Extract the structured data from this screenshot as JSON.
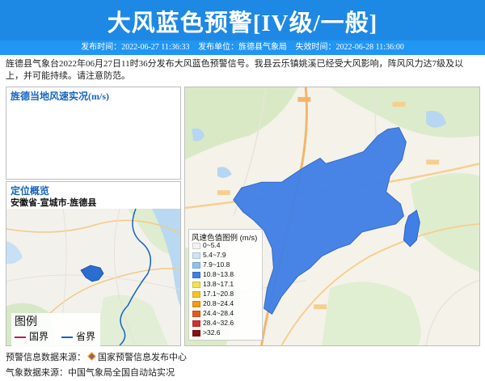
{
  "header": {
    "title": "大风蓝色预警[IV级/一般]",
    "publish_time": "发布时间：2022-06-27 11:36:33",
    "publisher": "发布单位：旌德县气象局",
    "expire_time": "失效时间：2022-06-28 11:36:00",
    "banner_color": "#1e88e5"
  },
  "description": "旌德县气象台2022年06月27日11时36分发布大风蓝色预警信号。我县云乐镇姚溪已经受大风影响，阵风风力达7级及以上，并可能持续。请注意防范。",
  "panels": {
    "wind_title": "旌德当地风速实况(m/s)",
    "location_title": "定位概览",
    "location_path": "安徽省-宣城市-旌德县"
  },
  "mini_legend": {
    "title": "图例",
    "items": [
      {
        "label": "国界",
        "color": "#c2185b"
      },
      {
        "label": "省界",
        "color": "#1565c0"
      }
    ]
  },
  "wind_legend": {
    "title": "风速色值图例 (m/s)",
    "items": [
      {
        "label": "0~5.4",
        "color": "#f2f2f2"
      },
      {
        "label": "5.4~7.9",
        "color": "#cfe3f7"
      },
      {
        "label": "7.9~10.8",
        "color": "#8ec3f0"
      },
      {
        "label": "10.8~13.8",
        "color": "#3f7fe6"
      },
      {
        "label": "13.8~17.1",
        "color": "#f4e04d"
      },
      {
        "label": "17.1~20.8",
        "color": "#f5c623"
      },
      {
        "label": "20.8~24.4",
        "color": "#f39c12"
      },
      {
        "label": "24.4~28.4",
        "color": "#e8581c"
      },
      {
        "label": "28.4~32.6",
        "color": "#d32f2f"
      },
      {
        "label": ">32.6",
        "color": "#8b1010"
      }
    ]
  },
  "footer": {
    "warning_source": "预警信息数据来源：",
    "warning_source_org": "国家预警信息发布中心",
    "weather_source": "气象数据来源：中国气象局全国自动站实况"
  }
}
